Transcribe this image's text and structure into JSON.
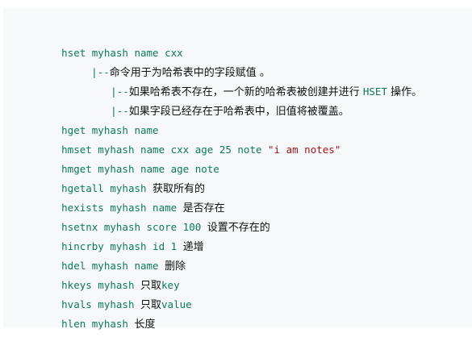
{
  "lines": [
    {
      "code": "hset myhash name cxx",
      "note": ""
    },
    {
      "code": "|--",
      "note": "命令用于为哈希表中的字段赋值 。"
    },
    {
      "code": "|--",
      "note": "如果哈希表不存在，一个新的哈希表被创建并进行 ",
      "code2": "HSET",
      "note2": " 操作。"
    },
    {
      "code": "|--",
      "note": "如果字段已经存在于哈希表中，旧值将被覆盖。"
    },
    {
      "code": "hget myhash name",
      "note": ""
    },
    {
      "code": "hmset myhash name cxx age 25 note ",
      "str": "\"i am notes\""
    },
    {
      "code": "hmget myhash name age note",
      "note": ""
    },
    {
      "code": "hgetall myhash ",
      "note": "获取所有的"
    },
    {
      "code": "hexists myhash name ",
      "note": "是否存在"
    },
    {
      "code": "hsetnx myhash score 100 ",
      "note": "设置不存在的"
    },
    {
      "code": "hincrby myhash id 1 ",
      "note": "递增"
    },
    {
      "code": "hdel myhash name ",
      "note": "删除"
    },
    {
      "code": "hkeys myhash ",
      "note": "只取",
      "code2": "key"
    },
    {
      "code": "hvals myhash ",
      "note": "只取",
      "code2": "value"
    },
    {
      "code": "hlen myhash ",
      "note": "长度"
    }
  ]
}
